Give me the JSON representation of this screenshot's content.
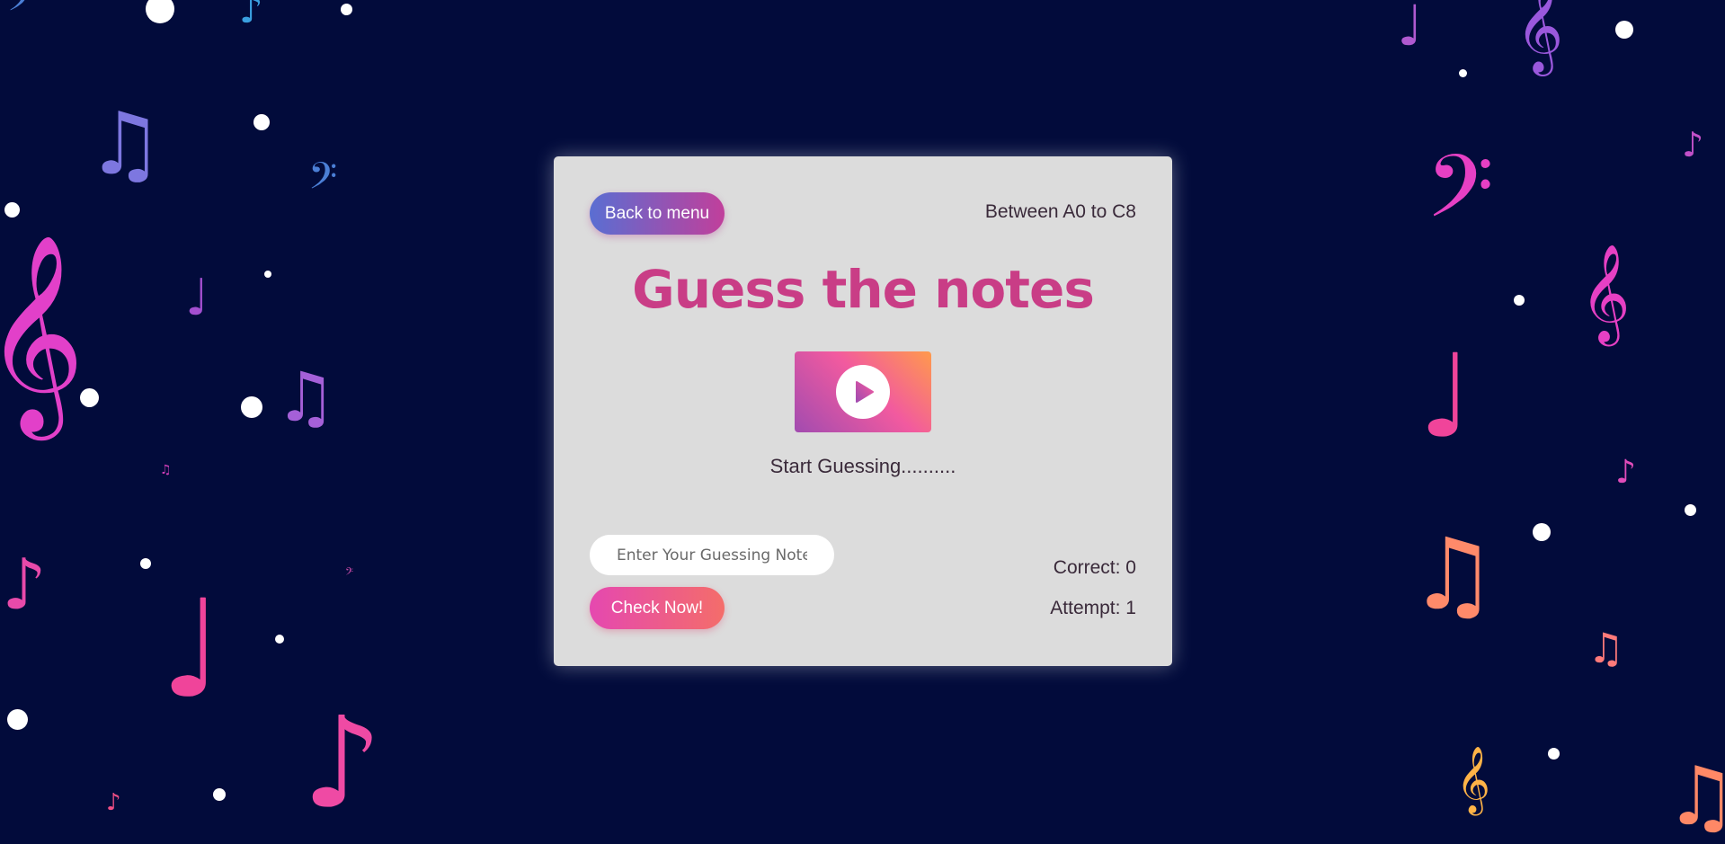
{
  "app": {
    "back_label": "Back to menu",
    "range_text": "Between A0 to C8",
    "title": "Guess the notes",
    "play_icon": "play-icon",
    "status_text": "Start Guessing..........",
    "input_placeholder": "Enter Your Guessing Notes",
    "input_value": "",
    "check_label": "Check Now!",
    "correct_text": "Correct: 0",
    "attempt_text": "Attempt: 1"
  },
  "colors": {
    "background": "#020b3b",
    "card": "#dcdcdc",
    "title": "#c93d86",
    "text": "#3a2a3a"
  }
}
